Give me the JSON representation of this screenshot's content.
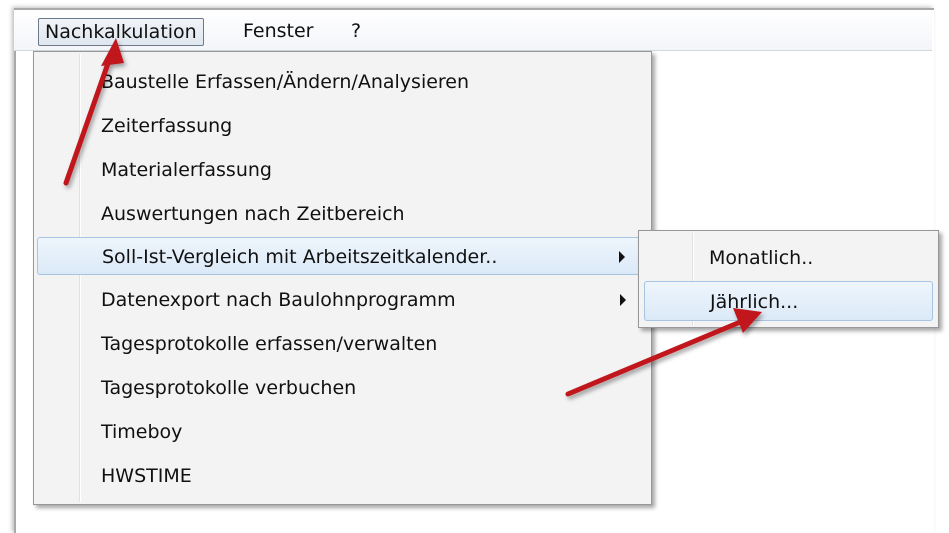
{
  "menubar": {
    "items": [
      {
        "label": "Nachkalkulation"
      },
      {
        "label": "Fenster"
      },
      {
        "label": "?"
      }
    ]
  },
  "dropdown": {
    "items": [
      {
        "label": "Baustelle Erfassen/Ändern/Analysieren"
      },
      {
        "label": "Zeiterfassung"
      },
      {
        "label": "Materialerfassung"
      },
      {
        "label": "Auswertungen nach Zeitbereich"
      },
      {
        "label": "Soll-Ist-Vergleich mit Arbeitszeitkalender.."
      },
      {
        "label": "Datenexport nach Baulohnprogramm"
      },
      {
        "label": "Tagesprotokolle erfassen/verwalten"
      },
      {
        "label": "Tagesprotokolle verbuchen"
      },
      {
        "label": "Timeboy"
      },
      {
        "label": "HWSTIME"
      }
    ]
  },
  "submenu": {
    "items": [
      {
        "label": "Monatlich.."
      },
      {
        "label": "Jährlich..."
      }
    ]
  },
  "colors": {
    "highlight": "#dbe9f7",
    "annotation_arrow": "#c0171d"
  }
}
